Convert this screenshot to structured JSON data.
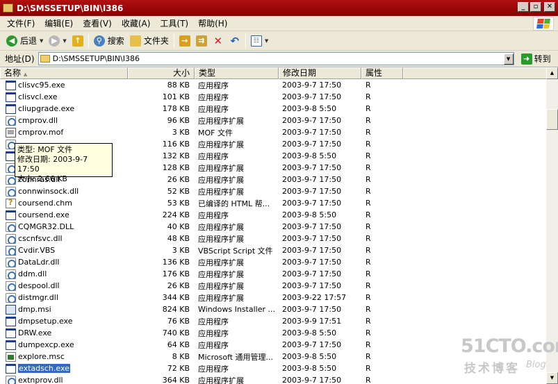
{
  "window": {
    "title": "D:\\SMSSETUP\\BIN\\I386",
    "min_glyph": "_",
    "max_glyph": "▫",
    "close_glyph": "✕"
  },
  "menu": [
    "文件(F)",
    "编辑(E)",
    "查看(V)",
    "收藏(A)",
    "工具(T)",
    "帮助(H)"
  ],
  "toolbar": {
    "back_label": "后退",
    "search_label": "搜索",
    "folders_label": "文件夹"
  },
  "address": {
    "label": "地址(D)",
    "value": "D:\\SMSSETUP\\BIN\\I386",
    "go_label": "转到"
  },
  "columns": {
    "name": "名称",
    "size": "大小",
    "type": "类型",
    "date": "修改日期",
    "attr": "属性"
  },
  "tooltip": {
    "type_line": "类型: MOF 文件",
    "date_line": "修改日期: 2003-9-7 17:50",
    "size_line": "大小: 2.66 KB"
  },
  "files": [
    {
      "name": "clisvc95.exe",
      "size": "88 KB",
      "type": "应用程序",
      "date": "2003-9-7 17:50",
      "attr": "R",
      "icon": "exe"
    },
    {
      "name": "clisvcl.exe",
      "size": "101 KB",
      "type": "应用程序",
      "date": "2003-9-7 17:50",
      "attr": "R",
      "icon": "exe"
    },
    {
      "name": "cliupgrade.exe",
      "size": "178 KB",
      "type": "应用程序",
      "date": "2003-9-8 5:50",
      "attr": "R",
      "icon": "exe"
    },
    {
      "name": "cmprov.dll",
      "size": "96 KB",
      "type": "应用程序扩展",
      "date": "2003-9-7 17:50",
      "attr": "R",
      "icon": "dll"
    },
    {
      "name": "cmprov.mof",
      "size": "3 KB",
      "type": "MOF 文件",
      "date": "2003-9-7 17:50",
      "attr": "R",
      "icon": "mof"
    },
    {
      "name": "",
      "size": "116 KB",
      "type": "应用程序扩展",
      "date": "2003-9-7 17:50",
      "attr": "R",
      "icon": "dll"
    },
    {
      "name": "",
      "size": "132 KB",
      "type": "应用程序",
      "date": "2003-9-8 5:50",
      "attr": "R",
      "icon": "exe"
    },
    {
      "name": "",
      "size": "128 KB",
      "type": "应用程序扩展",
      "date": "2003-9-7 17:50",
      "attr": "R",
      "icon": "dll"
    },
    {
      "name": "connras.dll",
      "size": "26 KB",
      "type": "应用程序扩展",
      "date": "2003-9-7 17:50",
      "attr": "R",
      "icon": "dll"
    },
    {
      "name": "connwinsock.dll",
      "size": "52 KB",
      "type": "应用程序扩展",
      "date": "2003-9-7 17:50",
      "attr": "R",
      "icon": "dll"
    },
    {
      "name": "coursend.chm",
      "size": "53 KB",
      "type": "已编译的 HTML 帮...",
      "date": "2003-9-7 17:50",
      "attr": "R",
      "icon": "chm"
    },
    {
      "name": "coursend.exe",
      "size": "224 KB",
      "type": "应用程序",
      "date": "2003-9-8 5:50",
      "attr": "R",
      "icon": "exe"
    },
    {
      "name": "CQMGR32.DLL",
      "size": "40 KB",
      "type": "应用程序扩展",
      "date": "2003-9-7 17:50",
      "attr": "R",
      "icon": "dll"
    },
    {
      "name": "cscnfsvc.dll",
      "size": "48 KB",
      "type": "应用程序扩展",
      "date": "2003-9-7 17:50",
      "attr": "R",
      "icon": "dll"
    },
    {
      "name": "Cvdir.VBS",
      "size": "3 KB",
      "type": "VBScript Script 文件",
      "date": "2003-9-7 17:50",
      "attr": "R",
      "icon": "vbs"
    },
    {
      "name": "DataLdr.dll",
      "size": "136 KB",
      "type": "应用程序扩展",
      "date": "2003-9-7 17:50",
      "attr": "R",
      "icon": "dll"
    },
    {
      "name": "ddm.dll",
      "size": "176 KB",
      "type": "应用程序扩展",
      "date": "2003-9-7 17:50",
      "attr": "R",
      "icon": "dll"
    },
    {
      "name": "despool.dll",
      "size": "26 KB",
      "type": "应用程序扩展",
      "date": "2003-9-7 17:50",
      "attr": "R",
      "icon": "dll"
    },
    {
      "name": "distmgr.dll",
      "size": "344 KB",
      "type": "应用程序扩展",
      "date": "2003-9-22 17:57",
      "attr": "R",
      "icon": "dll"
    },
    {
      "name": "dmp.msi",
      "size": "824 KB",
      "type": "Windows Installer ...",
      "date": "2003-9-7 17:50",
      "attr": "R",
      "icon": "msi"
    },
    {
      "name": "dmpsetup.exe",
      "size": "76 KB",
      "type": "应用程序",
      "date": "2003-9-9 17:51",
      "attr": "R",
      "icon": "exe"
    },
    {
      "name": "DRW.exe",
      "size": "740 KB",
      "type": "应用程序",
      "date": "2003-9-8 5:50",
      "attr": "R",
      "icon": "exe"
    },
    {
      "name": "dumpexcp.exe",
      "size": "64 KB",
      "type": "应用程序",
      "date": "2003-9-7 17:50",
      "attr": "R",
      "icon": "exe"
    },
    {
      "name": "explore.msc",
      "size": "8 KB",
      "type": "Microsoft 通用管理...",
      "date": "2003-9-8 5:50",
      "attr": "R",
      "icon": "msc"
    },
    {
      "name": "extadsch.exe",
      "size": "72 KB",
      "type": "应用程序",
      "date": "2003-9-8 5:50",
      "attr": "R",
      "icon": "exe",
      "selected": true
    },
    {
      "name": "extnprov.dll",
      "size": "364 KB",
      "type": "应用程序扩展",
      "date": "2003-9-7 17:50",
      "attr": "R",
      "icon": "dll"
    }
  ],
  "watermark": {
    "site": "51CTO.com",
    "tagline": "技术博客",
    "blog": "Blog"
  }
}
